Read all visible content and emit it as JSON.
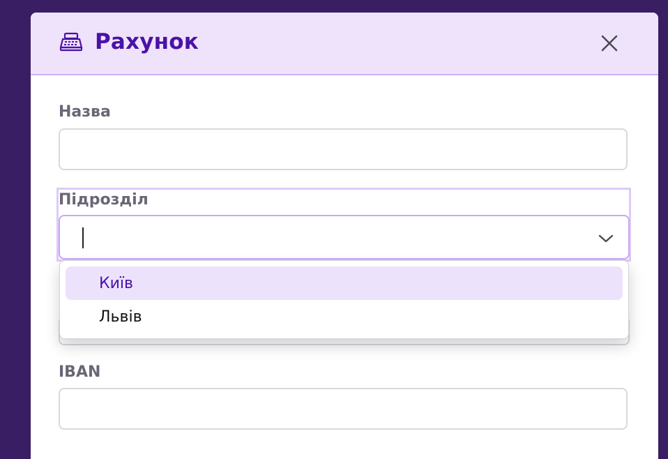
{
  "modal": {
    "title": "Рахунок",
    "icon": "cash-register-icon",
    "close_icon": "close-icon"
  },
  "fields": {
    "name": {
      "label": "Назва",
      "value": "",
      "placeholder": ""
    },
    "department": {
      "label": "Підрозділ",
      "value": "",
      "options": [
        {
          "label": "Київ",
          "highlighted": true
        },
        {
          "label": "Львів",
          "highlighted": false
        }
      ]
    },
    "iban": {
      "label": "IBAN",
      "value": "",
      "placeholder": ""
    }
  },
  "colors": {
    "backdrop": "#3a1e63",
    "header_bg": "#efe3fc",
    "accent": "#4b12a6",
    "option_highlight": "#ece2fc"
  }
}
